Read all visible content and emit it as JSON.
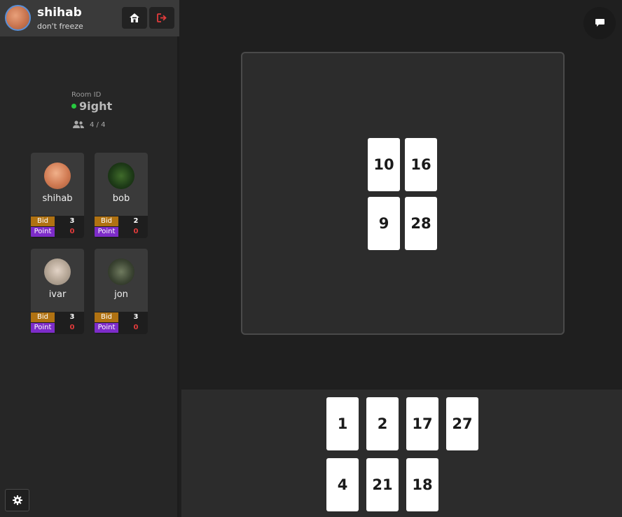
{
  "profile": {
    "name": "shihab",
    "status": "don't freeze"
  },
  "room": {
    "label": "Room ID",
    "id": "9ight",
    "players_count": "4 / 4"
  },
  "players": [
    {
      "name": "shihab",
      "bid": "3",
      "point": "0"
    },
    {
      "name": "bob",
      "bid": "2",
      "point": "0"
    },
    {
      "name": "ivar",
      "bid": "3",
      "point": "0"
    },
    {
      "name": "jon",
      "bid": "3",
      "point": "0"
    }
  ],
  "stat_labels": {
    "bid": "Bid",
    "point": "Point"
  },
  "table_cards": [
    "10",
    "16",
    "9",
    "28"
  ],
  "hand_cards": [
    "1",
    "2",
    "17",
    "27",
    "4",
    "21",
    "18"
  ],
  "colors": {
    "accent_online": "#27c93f",
    "bid": "#b07212",
    "point": "#7d2cc9",
    "logout": "#e23b3b"
  },
  "icons": {
    "home": "home-icon",
    "logout": "logout-icon",
    "players": "users-icon",
    "settings": "gear-icon",
    "chat": "chat-icon"
  }
}
